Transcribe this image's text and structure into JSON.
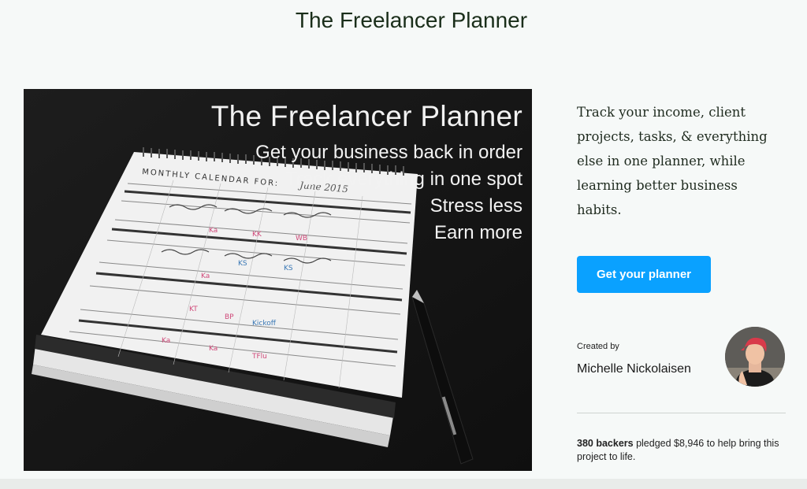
{
  "page": {
    "title": "The Freelancer Planner"
  },
  "hero": {
    "title": "The Freelancer Planner",
    "lines": [
      "Get your business back in order",
      "Track everything in one spot",
      "Stress less",
      "Earn more"
    ],
    "calendar_heading": "MONTHLY CALENDAR FOR:",
    "calendar_month": "June 2015"
  },
  "sidebar": {
    "blurb": "Track your income, client projects, tasks, & everything else in one planner, while learning better business habits.",
    "cta_label": "Get your planner",
    "created_by_label": "Created by",
    "creator_name": "Michelle Nickolaisen",
    "backers_count": "380 backers",
    "backers_text": " pledged $8,946 to help bring this project to life."
  },
  "colors": {
    "accent": "#0aa1ff",
    "title": "#1a2e1a",
    "background": "#f6f9f8"
  }
}
